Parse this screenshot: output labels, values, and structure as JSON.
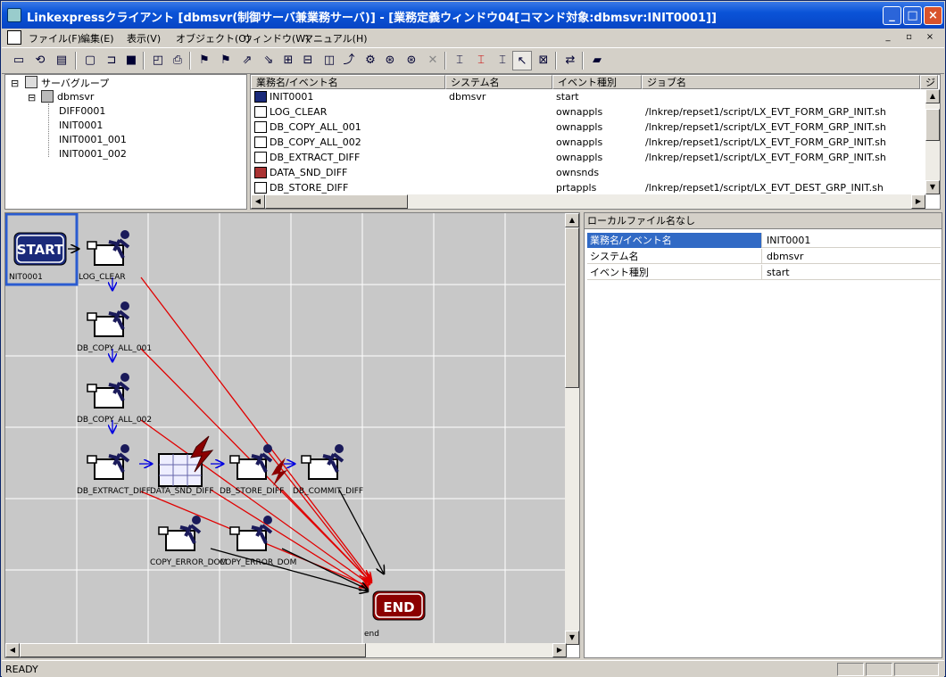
{
  "window": {
    "title": "Linkexpressクライアント [dbmsvr(制御サーバ兼業務サーバ)] - [業務定義ウィンドウ04[コマンド対象:dbmsvr:INIT0001]]"
  },
  "menu": [
    "ファイル(F)",
    "編集(E)",
    "表示(V)",
    "オブジェクト(O)",
    "ウィンドウ(W)",
    "マニュアル(H)"
  ],
  "tree": {
    "root": "サーバグループ",
    "server": "dbmsvr",
    "items": [
      "DIFF0001",
      "INIT0001",
      "INIT0001_001",
      "INIT0001_002"
    ]
  },
  "list": {
    "columns": [
      "業務名/イベント名",
      "システム名",
      "イベント種別",
      "ジョブ名",
      "ジ"
    ],
    "rows": [
      {
        "name": "INIT0001",
        "system": "dbmsvr",
        "type": "start",
        "job": ""
      },
      {
        "name": "LOG_CLEAR",
        "system": "",
        "type": "ownappls",
        "job": "/lnkrep/repset1/script/LX_EVT_FORM_GRP_INIT.sh"
      },
      {
        "name": "DB_COPY_ALL_001",
        "system": "",
        "type": "ownappls",
        "job": "/lnkrep/repset1/script/LX_EVT_FORM_GRP_INIT.sh"
      },
      {
        "name": "DB_COPY_ALL_002",
        "system": "",
        "type": "ownappls",
        "job": "/lnkrep/repset1/script/LX_EVT_FORM_GRP_INIT.sh"
      },
      {
        "name": "DB_EXTRACT_DIFF",
        "system": "",
        "type": "ownappls",
        "job": "/lnkrep/repset1/script/LX_EVT_FORM_GRP_INIT.sh"
      },
      {
        "name": "DATA_SND_DIFF",
        "system": "",
        "type": "ownsnds",
        "job": ""
      },
      {
        "name": "DB_STORE_DIFF",
        "system": "",
        "type": "prtappls",
        "job": "/lnkrep/repset1/script/LX_EVT_DEST_GRP_INIT.sh"
      }
    ]
  },
  "flow": {
    "start_label": "START",
    "start_caption": "NIT0001",
    "end_label": "END",
    "end_caption": "end",
    "nodes": {
      "log_clear": "LOG_CLEAR",
      "copy_all_001": "DB_COPY_ALL_001",
      "copy_all_002": "DB_COPY_ALL_002",
      "extract": "DB_EXTRACT_DIFF",
      "snd": "DATA_SND_DIFF",
      "store": "DB_STORE_DIFF",
      "commit": "DB_COMMIT_DIFF",
      "copy_err1": "COPY_ERROR_DOM",
      "copy_err2": "COPY_ERROR_DOM"
    }
  },
  "props": {
    "header": "ローカルファイル名なし",
    "rows": [
      {
        "key": "業務名/イベント名",
        "value": "INIT0001"
      },
      {
        "key": "システム名",
        "value": "dbmsvr"
      },
      {
        "key": "イベント種別",
        "value": "start"
      }
    ]
  },
  "status": {
    "text": "READY"
  },
  "colors": {
    "accent": "#316ac5",
    "error_arrow": "#e00000",
    "ok_arrow": "#0000e0",
    "end_badge": "#8b0000",
    "start_badge": "#1a2a7a"
  }
}
